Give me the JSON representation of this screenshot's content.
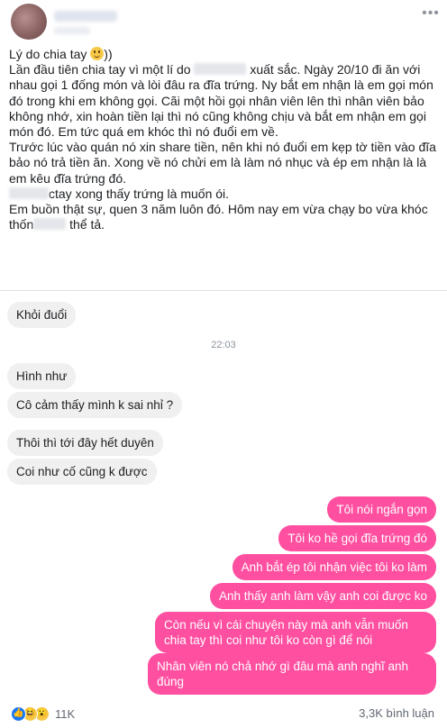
{
  "post": {
    "more_label": "•••",
    "text": {
      "l1": "Lý do chia tay ",
      "l1_tail": "))",
      "l2a": "Lần đầu tiên chia tay vì một lí do ",
      "l2b": " xuất sắc. Ngày 20/10 đi ăn với",
      "l3": "nhau gọi 1 đống món và lòi đâu ra đĩa trứng. Ny bắt em nhận là em gọi món",
      "l4": "đó trong khi em không gọi. Cãi một hồi gọi nhân viên lên thì nhân viên bảo",
      "l5": "không nhớ, xin hoàn tiền lại thì nó cũng không chịu và bắt em nhận em gọi",
      "l6": "món đó. Em tức quá em khóc thì nó đuổi em về.",
      "l7": "Trước lúc vào quán nó xin share tiền, nên khi nó đuổi em kẹp tờ tiền vào đĩa",
      "l8": "bảo nó trả tiền ăn. Xong về nó chửi em là làm nó nhục và ép em nhận là là",
      "l9": "em kêu đĩa trứng đó.",
      "l10": "ctay xong thấy trứng là muốn ói.",
      "l11": "Em buồn thật sự, quen 3 năm luôn đó. Hôm nay em vừa chạy bo vừa khóc",
      "l12a": "thốn",
      "l12b": " thể tả."
    }
  },
  "chat": {
    "timestamp": "22:03",
    "received": [
      "Khỏi đuổi",
      "Hình như",
      "Cô cảm thấy mình k sai nhỉ ?",
      "Thôi thì tới đây hết duyên",
      "Coi như cố cũng k được"
    ],
    "sent": [
      "Tôi nói ngắn gọn",
      "Tôi ko hề gọi đĩa trứng đó",
      "Anh bắt ép tôi nhận việc tôi ko làm",
      "Anh thấy anh làm vậy anh coi được ko",
      "Còn nếu vì cái chuyện này mà anh vẫn muốn chia tay thì coi như tôi ko còn gì để nói",
      "Nhân viên nó chả nhớ gì đâu mà anh nghĩ anh đúng"
    ]
  },
  "footer": {
    "reaction_count": "11K",
    "comment_count": "3,3K bình luận"
  },
  "colors": {
    "sent_bubble": "#ff4fa0",
    "received_bubble": "#f1f0f0",
    "like_blue": "#1877f2"
  },
  "icons": {
    "like": "thumbs-up-icon",
    "haha": "haha-icon",
    "wow": "wow-icon",
    "smile": "smile-emoji-icon"
  }
}
